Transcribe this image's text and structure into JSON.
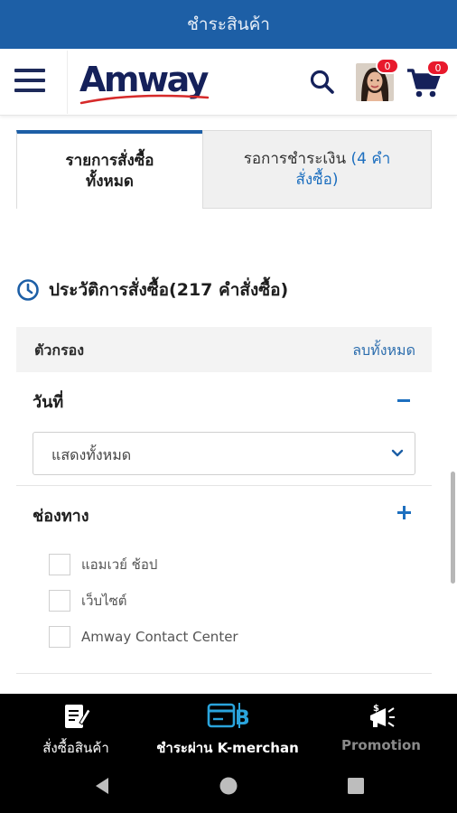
{
  "app": {
    "title": "ชำระสินค้า"
  },
  "header": {
    "logo_text": "Amway",
    "avatar_badge": "0",
    "cart_badge": "0",
    "icons": [
      "menu-icon",
      "search-icon",
      "avatar",
      "cart-icon"
    ]
  },
  "tabs": [
    {
      "label_line1": "รายการสั่งซื้อ",
      "label_line2": "ทั้งหมด",
      "active": true
    },
    {
      "label_line1": "รอการชำระเงิน",
      "count_line1": "(4 คำ",
      "count_line2": "สั่งซื้อ)",
      "active": false
    }
  ],
  "history": {
    "title": "ประวัติการสั่งซื้อ(217 คำสั่งซื้อ)",
    "icon": "clock-icon"
  },
  "filter": {
    "label": "ตัวกรอง",
    "clear_all": "ลบทั้งหมด",
    "date": {
      "title": "วันที่",
      "selected": "แสดงทั้งหมด"
    },
    "channel": {
      "title": "ช่องทาง",
      "options": [
        "แอมเวย์ ช้อป",
        "เว็บไซต์",
        "Amway Contact Center"
      ]
    }
  },
  "bottom_nav": [
    {
      "label": "สั่งซื้อสินค้า",
      "icon": "order-form-icon",
      "active": false
    },
    {
      "label": "ชำระผ่าน K-merchan",
      "icon": "kbank-card-icon",
      "active": true
    },
    {
      "label": "Promotion",
      "icon": "megaphone-icon",
      "active": false
    }
  ],
  "system_nav": [
    "back-icon",
    "home-icon",
    "recents-icon"
  ],
  "colors": {
    "title_bar": "#1d5fa6",
    "brand_navy": "#15215a",
    "link_blue": "#2d6eae",
    "badge_red": "#e8192c",
    "kbank_blue": "#2aa4dc"
  }
}
